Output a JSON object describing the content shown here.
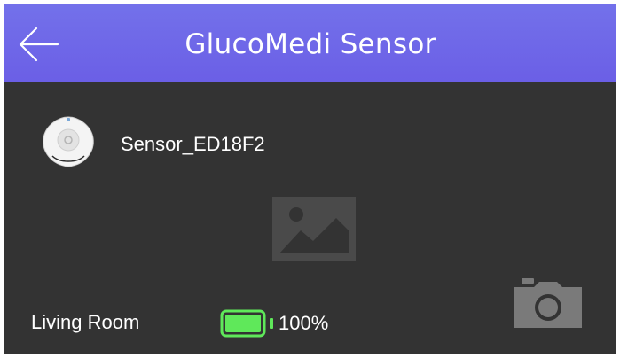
{
  "header": {
    "title": "GlucoMedi Sensor",
    "background": "#6f69e8",
    "back_icon": "arrow-left-icon"
  },
  "device": {
    "name": "Sensor_ED18F2",
    "icon": "sensor-device-icon"
  },
  "photo": {
    "icon": "image-placeholder-icon"
  },
  "status": {
    "location": "Living Room",
    "battery_percent": "100%",
    "battery_level": 1.0,
    "battery_color": "#5fe85a"
  },
  "actions": {
    "camera_icon": "camera-icon"
  },
  "colors": {
    "background": "#333333",
    "text": "#ffffff",
    "placeholder_icon": "#4a4a4a",
    "camera_icon": "#7a7a7a"
  }
}
